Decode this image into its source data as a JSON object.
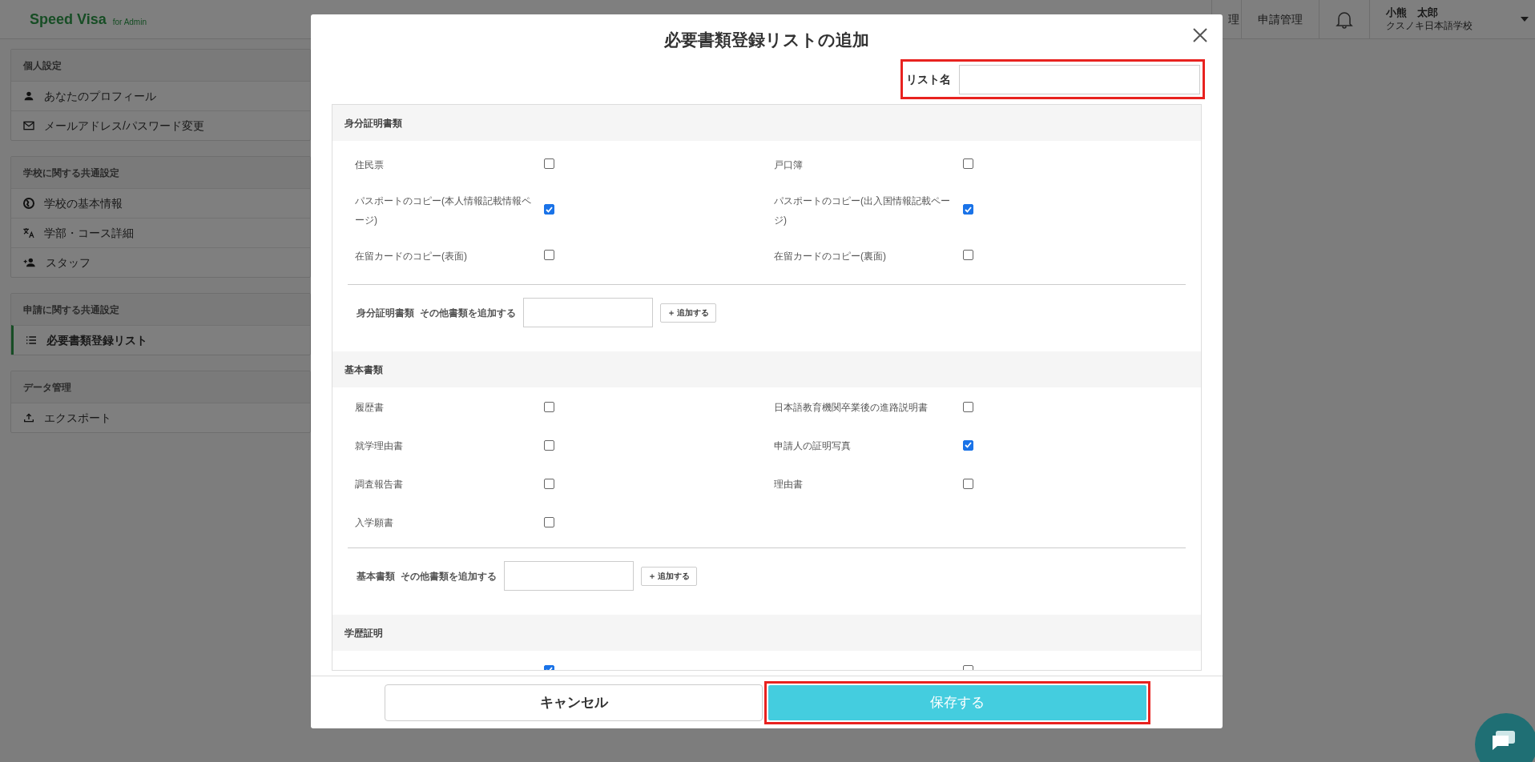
{
  "header": {
    "logo": "Speed Visa",
    "logo_sub": "for Admin",
    "nav": [
      {
        "label": "理"
      },
      {
        "label": "申請管理"
      }
    ],
    "user_name": "小熊　太郎",
    "user_school": "クスノキ日本語学校"
  },
  "sidebar": [
    {
      "title": "個人設定",
      "items": [
        {
          "label": "あなたのプロフィール",
          "selected": false
        },
        {
          "label": "メールアドレス/パスワード変更",
          "selected": false
        }
      ]
    },
    {
      "title": "学校に関する共通設定",
      "items": [
        {
          "label": "学校の基本情報",
          "selected": false
        },
        {
          "label": "学部・コース詳細",
          "selected": false
        },
        {
          "label": "スタッフ",
          "selected": false
        }
      ]
    },
    {
      "title": "申請に関する共通設定",
      "items": [
        {
          "label": "必要書類登録リスト",
          "selected": true
        }
      ]
    },
    {
      "title": "データ管理",
      "items": [
        {
          "label": "エクスポート",
          "selected": false
        }
      ]
    }
  ],
  "modal": {
    "title": "必要書類登録リストの追加",
    "list_name_label": "リスト名",
    "sections": [
      {
        "title": "身分証明書類",
        "items": [
          {
            "label": "住民票",
            "checked": false
          },
          {
            "label": "戸口簿",
            "checked": false
          },
          {
            "label": "パスポートのコピー(本人情報記載情報ページ)",
            "checked": true
          },
          {
            "label": "パスポートのコピー(出入国情報記載ページ)",
            "checked": true
          },
          {
            "label": "在留カードのコピー(表面)",
            "checked": false
          },
          {
            "label": "在留カードのコピー(裏面)",
            "checked": false
          }
        ],
        "add_label": "身分証明書類  その他書類を追加する",
        "add_button": "＋ 追加する"
      },
      {
        "title": "基本書類",
        "items": [
          {
            "label": "履歴書",
            "checked": false
          },
          {
            "label": "日本語教育機関卒業後の進路説明書",
            "checked": false
          },
          {
            "label": "就学理由書",
            "checked": false
          },
          {
            "label": "申請人の証明写真",
            "checked": true
          },
          {
            "label": "調査報告書",
            "checked": false
          },
          {
            "label": "理由書",
            "checked": false
          },
          {
            "label": "入学願書",
            "checked": false
          }
        ],
        "add_label": "基本書類  その他書類を追加する",
        "add_button": "＋ 追加する"
      },
      {
        "title": "学歴証明",
        "items": [
          {
            "checked": true
          },
          {
            "checked": false
          }
        ]
      }
    ],
    "cancel_button": "キャンセル",
    "save_button": "保存する"
  }
}
